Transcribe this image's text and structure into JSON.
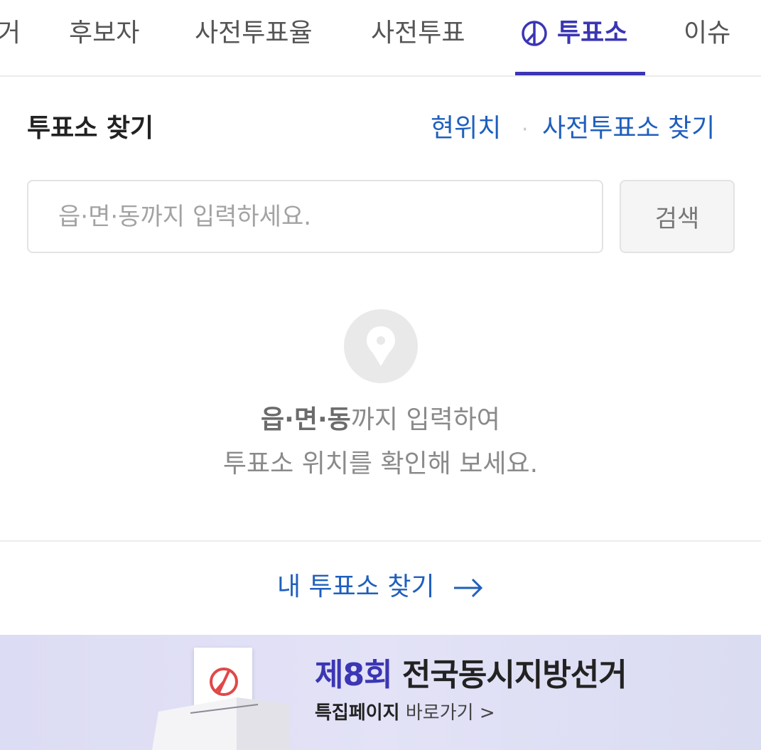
{
  "tabs": [
    {
      "label": "거",
      "active": false
    },
    {
      "label": "후보자",
      "active": false
    },
    {
      "label": "사전투표율",
      "active": false
    },
    {
      "label": "사전투표",
      "active": false
    },
    {
      "label": "투표소",
      "active": true,
      "icon": "vote-mark-icon"
    },
    {
      "label": "이슈",
      "active": false
    }
  ],
  "section": {
    "title": "투표소 찾기",
    "link_current": "현위치",
    "link_separator": "·",
    "link_early": "사전투표소 찾기"
  },
  "search": {
    "placeholder": "읍·면·동까지 입력하세요.",
    "value": "",
    "button_label": "검색"
  },
  "empty_state": {
    "icon": "location-pin-icon",
    "line1_bold": "읍·면·동",
    "line1_rest": "까지 입력하여",
    "line2": "투표소 위치를 확인해 보세요."
  },
  "my_poll": {
    "label": "내 투표소 찾기",
    "icon": "arrow-right-icon"
  },
  "banner": {
    "title_highlight": "제8회",
    "title_rest": " 전국동시지방선거",
    "sub_bold": "특집페이지",
    "sub_rest": " 바로가기 >",
    "icon": "ballot-box-icon"
  },
  "colors": {
    "accent": "#3b36b3",
    "link": "#1f5fbd",
    "muted": "#8a8a8a",
    "border": "#e3e3e3",
    "stamp": "#e04848"
  }
}
